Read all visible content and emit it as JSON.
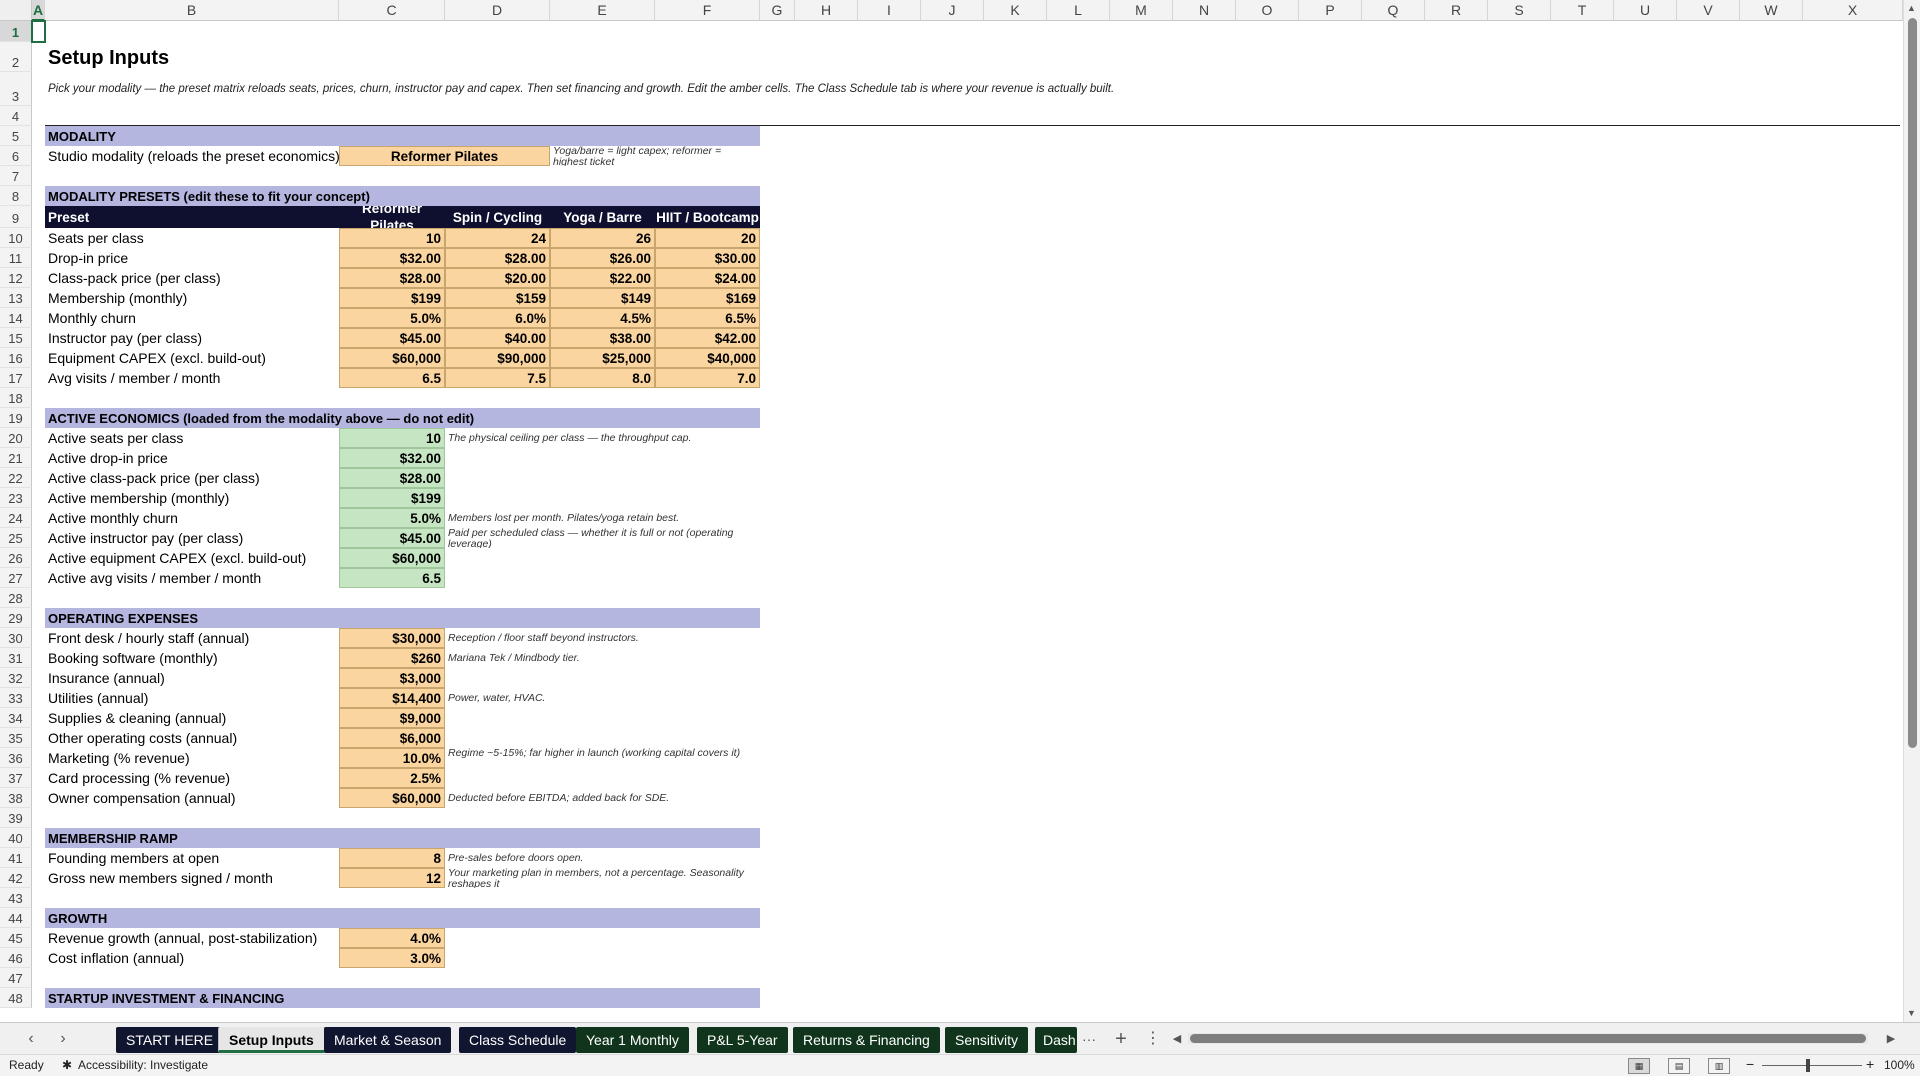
{
  "columns": [
    "A",
    "B",
    "C",
    "D",
    "E",
    "F",
    "G",
    "H",
    "I",
    "J",
    "K",
    "L",
    "M",
    "N",
    "O",
    "P",
    "Q",
    "R",
    "S",
    "T",
    "U",
    "V",
    "W",
    "X"
  ],
  "rows": [
    "1",
    "2",
    "3",
    "4",
    "5",
    "6",
    "7",
    "8",
    "9",
    "10",
    "11",
    "12",
    "13",
    "14",
    "15",
    "16",
    "17",
    "18",
    "19",
    "20",
    "21",
    "22",
    "23",
    "24",
    "25",
    "26",
    "27",
    "28",
    "29",
    "30",
    "31",
    "32",
    "33",
    "34",
    "35",
    "36",
    "37",
    "38",
    "39",
    "40",
    "41",
    "42",
    "43",
    "44",
    "45",
    "46",
    "47",
    "48"
  ],
  "selected_cell": "A1",
  "sheet": {
    "title": "Setup Inputs",
    "subtitle": "Pick your modality — the preset matrix reloads seats, prices, churn, instructor pay and capex. Then set financing and growth. Edit the amber cells. The Class Schedule tab is where your revenue is actually built.",
    "modality": {
      "header": "MODALITY",
      "label": "Studio modality (reloads the preset economics)",
      "value": "Reformer Pilates",
      "note": "Yoga/barre = light capex; reformer = highest ticket"
    },
    "presets": {
      "header": "MODALITY PRESETS  (edit these to fit your concept)",
      "col_preset": "Preset",
      "col_reformer_1": "Reformer",
      "col_reformer_2": "Pilates",
      "col_spin": "Spin / Cycling",
      "col_yoga": "Yoga / Barre",
      "col_hiit": "HIIT / Bootcamp",
      "rows": [
        {
          "label": "Seats per class",
          "v": [
            "10",
            "24",
            "26",
            "20"
          ]
        },
        {
          "label": "Drop-in price",
          "v": [
            "$32.00",
            "$28.00",
            "$26.00",
            "$30.00"
          ]
        },
        {
          "label": "Class-pack price (per class)",
          "v": [
            "$28.00",
            "$20.00",
            "$22.00",
            "$24.00"
          ]
        },
        {
          "label": "Membership (monthly)",
          "v": [
            "$199",
            "$159",
            "$149",
            "$169"
          ]
        },
        {
          "label": "Monthly churn",
          "v": [
            "5.0%",
            "6.0%",
            "4.5%",
            "6.5%"
          ]
        },
        {
          "label": "Instructor pay (per class)",
          "v": [
            "$45.00",
            "$40.00",
            "$38.00",
            "$42.00"
          ]
        },
        {
          "label": "Equipment CAPEX (excl. build-out)",
          "v": [
            "$60,000",
            "$90,000",
            "$25,000",
            "$40,000"
          ]
        },
        {
          "label": "Avg visits / member / month",
          "v": [
            "6.5",
            "7.5",
            "8.0",
            "7.0"
          ]
        }
      ]
    },
    "active": {
      "header": "ACTIVE ECONOMICS  (loaded from the modality above — do not edit)",
      "rows": [
        {
          "label": "Active seats per class",
          "value": "10",
          "note": "The physical ceiling per class — the throughput cap."
        },
        {
          "label": "Active drop-in price",
          "value": "$32.00",
          "note": ""
        },
        {
          "label": "Active class-pack price (per class)",
          "value": "$28.00",
          "note": ""
        },
        {
          "label": "Active membership (monthly)",
          "value": "$199",
          "note": ""
        },
        {
          "label": "Active monthly churn",
          "value": "5.0%",
          "note": "Members lost per month. Pilates/yoga retain best."
        },
        {
          "label": "Active instructor pay (per class)",
          "value": "$45.00",
          "note": "Paid per scheduled class — whether it is full or not (operating leverage)"
        },
        {
          "label": "Active equipment CAPEX (excl. build-out)",
          "value": "$60,000",
          "note": ""
        },
        {
          "label": "Active avg visits / member / month",
          "value": "6.5",
          "note": ""
        }
      ]
    },
    "opex": {
      "header": "OPERATING EXPENSES",
      "rows": [
        {
          "label": "Front desk / hourly staff (annual)",
          "value": "$30,000",
          "note": "Reception / floor staff beyond instructors."
        },
        {
          "label": "Booking software (monthly)",
          "value": "$260",
          "note": "Mariana Tek / Mindbody tier."
        },
        {
          "label": "Insurance (annual)",
          "value": "$3,000",
          "note": ""
        },
        {
          "label": "Utilities (annual)",
          "value": "$14,400",
          "note": "Power, water, HVAC."
        },
        {
          "label": "Supplies & cleaning (annual)",
          "value": "$9,000",
          "note": ""
        },
        {
          "label": "Other operating costs (annual)",
          "value": "$6,000",
          "note": ""
        },
        {
          "label": "Marketing (% revenue)",
          "value": "10.0%",
          "note": "Regime ~5-15%; far higher in launch (working capital covers it)"
        },
        {
          "label": "Card processing (% revenue)",
          "value": "2.5%",
          "note": ""
        },
        {
          "label": "Owner compensation (annual)",
          "value": "$60,000",
          "note": "Deducted before EBITDA; added back for SDE."
        }
      ]
    },
    "ramp": {
      "header": "MEMBERSHIP RAMP",
      "rows": [
        {
          "label": "Founding members at open",
          "value": "8",
          "note": "Pre-sales before doors open."
        },
        {
          "label": "Gross new members signed / month",
          "value": "12",
          "note": "Your marketing plan in members, not a percentage. Seasonality reshapes it"
        }
      ]
    },
    "growth": {
      "header": "GROWTH",
      "rows": [
        {
          "label": "Revenue growth (annual, post-stabilization)",
          "value": "4.0%",
          "note": ""
        },
        {
          "label": "Cost inflation (annual)",
          "value": "3.0%",
          "note": ""
        }
      ]
    },
    "startup": {
      "header": "STARTUP INVESTMENT & FINANCING"
    }
  },
  "tabs": [
    {
      "label": "START HERE",
      "color": "#101530"
    },
    {
      "label": "Setup Inputs",
      "color": "#e6e6e6",
      "active": true
    },
    {
      "label": "Market & Season",
      "color": "#101530"
    },
    {
      "label": "Class Schedule",
      "color": "#101530"
    },
    {
      "label": "Year 1 Monthly",
      "color": "#10351c"
    },
    {
      "label": "P&L 5-Year",
      "color": "#10351c"
    },
    {
      "label": "Returns & Financing",
      "color": "#10351c"
    },
    {
      "label": "Sensitivity",
      "color": "#10351c"
    },
    {
      "label": "Dash",
      "color": "#10351c"
    }
  ],
  "tabbar": {
    "more": "···",
    "add": "+",
    "options": "⋮"
  },
  "status": {
    "ready": "Ready",
    "accessibility": "Accessibility: Investigate",
    "zoom": "100%"
  }
}
